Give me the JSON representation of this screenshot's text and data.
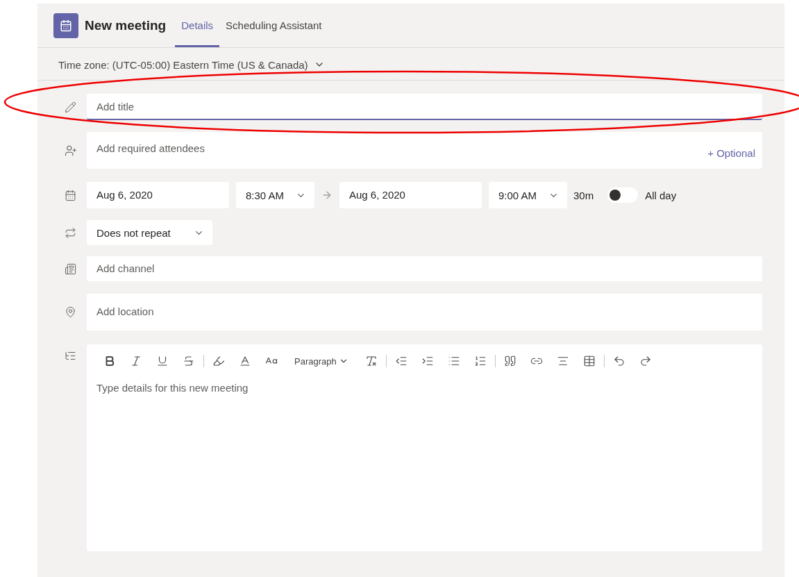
{
  "header": {
    "title": "New meeting",
    "tabs": [
      {
        "label": "Details",
        "selected": true
      },
      {
        "label": "Scheduling Assistant",
        "selected": false
      }
    ]
  },
  "time_zone": "Time zone: (UTC-05:00) Eastern Time (US & Canada)",
  "title_field": {
    "placeholder": "Add title",
    "focused": true
  },
  "attendees": {
    "placeholder": "Add required attendees",
    "optional_link": "+ Optional"
  },
  "schedule": {
    "start_date": "Aug 6, 2020",
    "start_time": "8:30 AM",
    "end_date": "Aug 6, 2020",
    "end_time": "9:00 AM",
    "duration": "30m",
    "all_day": {
      "label": "All day",
      "on": false
    }
  },
  "repeat": "Does not repeat",
  "channel": {
    "placeholder": "Add channel"
  },
  "location": {
    "placeholder": "Add location"
  },
  "editor": {
    "paragraph_label": "Paragraph",
    "placeholder": "Type details for this new meeting",
    "toolbar": [
      {
        "kind": "bold"
      },
      {
        "kind": "italic"
      },
      {
        "kind": "underline"
      },
      {
        "kind": "strikethrough"
      },
      {
        "kind": "separator"
      },
      {
        "kind": "highlight"
      },
      {
        "kind": "font-color"
      },
      {
        "kind": "font-size"
      },
      {
        "kind": "paragraph"
      },
      {
        "kind": "clear-format"
      },
      {
        "kind": "separator"
      },
      {
        "kind": "outdent"
      },
      {
        "kind": "indent"
      },
      {
        "kind": "bullets"
      },
      {
        "kind": "numbering"
      },
      {
        "kind": "separator"
      },
      {
        "kind": "quote"
      },
      {
        "kind": "link"
      },
      {
        "kind": "rule"
      },
      {
        "kind": "table"
      },
      {
        "kind": "separator"
      },
      {
        "kind": "undo"
      },
      {
        "kind": "redo"
      }
    ]
  },
  "annotation": {
    "kind": "ellipse"
  }
}
